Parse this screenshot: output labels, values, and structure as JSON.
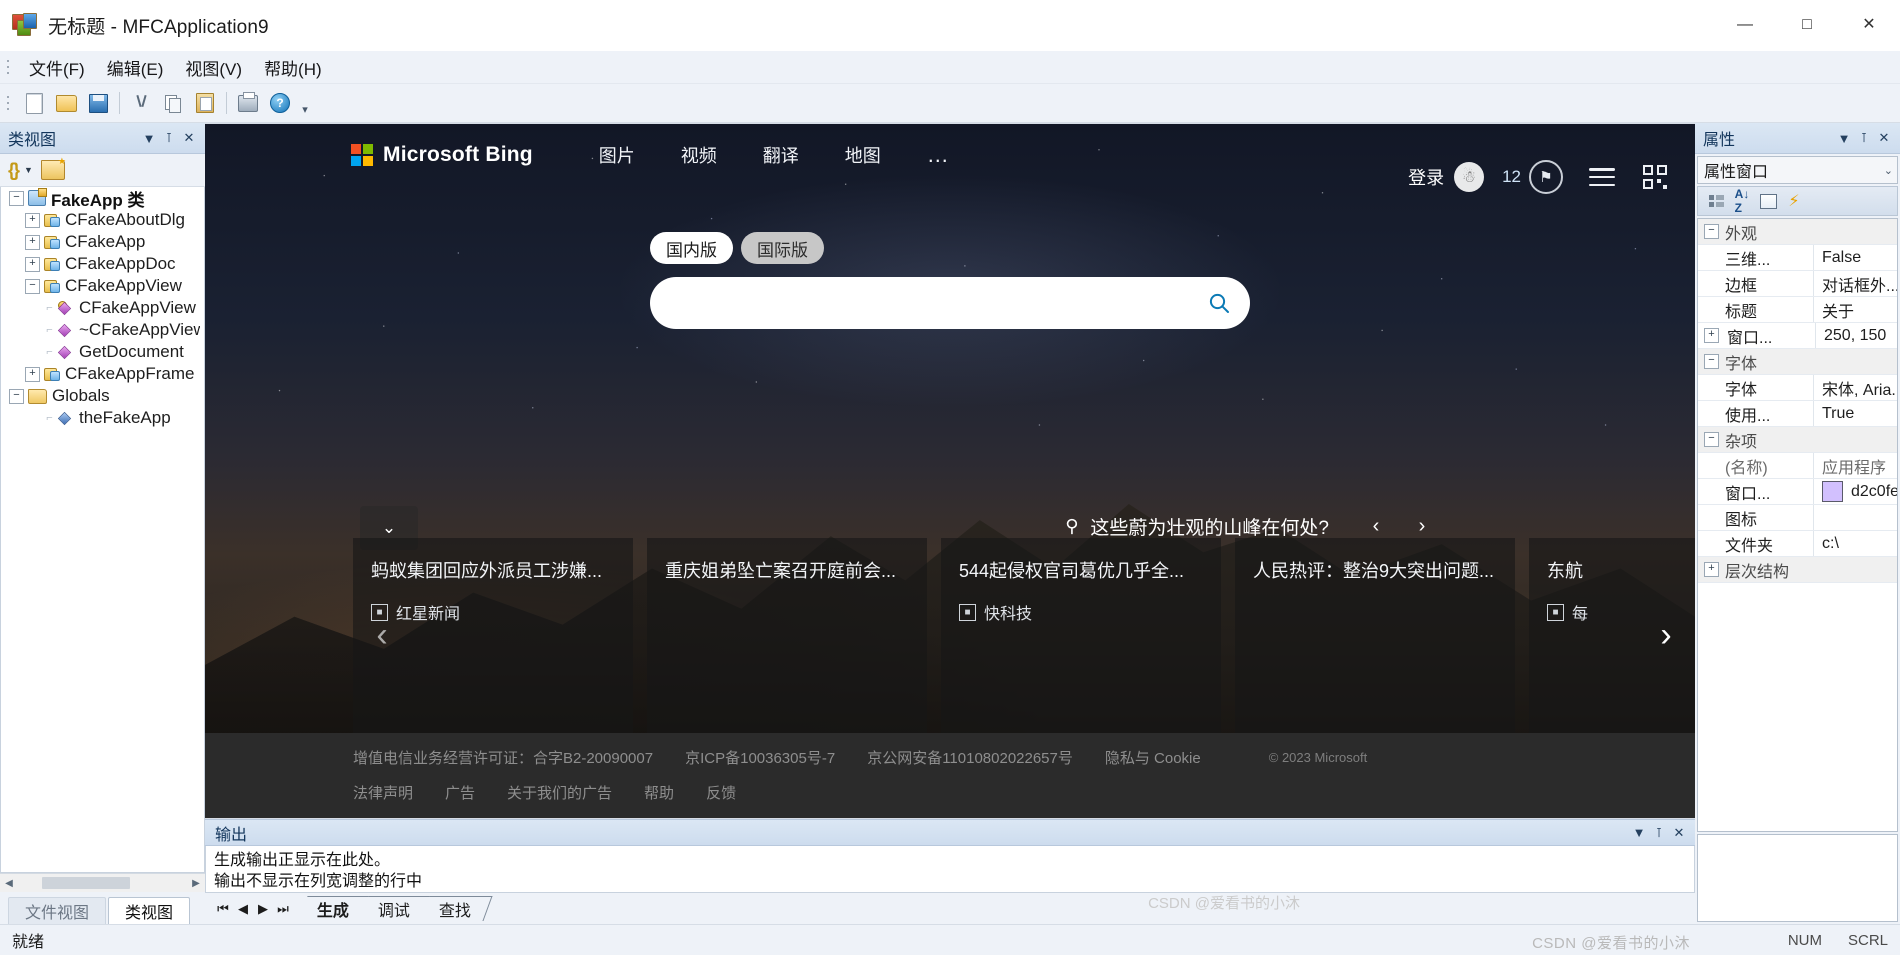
{
  "window": {
    "title": "无标题 - MFCApplication9",
    "app_icon": "mfc-app-icon",
    "minimize": "—",
    "maximize": "□",
    "close": "✕"
  },
  "menubar": {
    "items": [
      {
        "label": "文件(F)",
        "name": "menu-file"
      },
      {
        "label": "编辑(E)",
        "name": "menu-edit"
      },
      {
        "label": "视图(V)",
        "name": "menu-view"
      },
      {
        "label": "帮助(H)",
        "name": "menu-help"
      }
    ]
  },
  "toolbar": {
    "buttons": [
      "new-document-icon",
      "open-folder-icon",
      "save-icon",
      "cut-icon",
      "copy-icon",
      "paste-icon",
      "print-icon",
      "help-icon"
    ],
    "overflow": "▾"
  },
  "class_view": {
    "header_title": "类视图",
    "header_buttons": [
      "dropdown-icon",
      "pin-icon",
      "close-icon"
    ],
    "toolbar": {
      "braces": "{}",
      "caret": "▾",
      "new_folder": "new-folder-icon"
    },
    "tree": [
      {
        "indent": 0,
        "expander": "−",
        "icon": "project-icon",
        "label": "FakeApp 类",
        "bold": true
      },
      {
        "indent": 1,
        "expander": "+",
        "icon": "class-icon",
        "label": "CFakeAboutDlg"
      },
      {
        "indent": 1,
        "expander": "+",
        "icon": "class-icon",
        "label": "CFakeApp"
      },
      {
        "indent": 1,
        "expander": "+",
        "icon": "class-icon",
        "label": "CFakeAppDoc"
      },
      {
        "indent": 1,
        "expander": "−",
        "icon": "class-icon",
        "label": "CFakeAppView"
      },
      {
        "indent": 2,
        "expander": "",
        "icon": "member-key-icon",
        "label": "CFakeAppView"
      },
      {
        "indent": 2,
        "expander": "",
        "icon": "member-icon",
        "label": "~CFakeAppView"
      },
      {
        "indent": 2,
        "expander": "",
        "icon": "member-icon",
        "label": "GetDocument"
      },
      {
        "indent": 1,
        "expander": "+",
        "icon": "class-icon",
        "label": "CFakeAppFrame"
      },
      {
        "indent": 0,
        "expander": "−",
        "icon": "folder-icon",
        "label": "Globals"
      },
      {
        "indent": 1,
        "expander": "",
        "icon": "member-blue-icon",
        "label": "theFakeApp"
      }
    ],
    "tabs": [
      {
        "label": "文件视图",
        "active": false
      },
      {
        "label": "类视图",
        "active": true
      }
    ]
  },
  "bing": {
    "logo_text": "Microsoft Bing",
    "nav_links": [
      "图片",
      "视频",
      "翻译",
      "地图"
    ],
    "more_dots": "…",
    "sign_in": "登录",
    "rewards_count": "12",
    "market_tabs": [
      {
        "label": "国内版",
        "active": true
      },
      {
        "label": "国际版",
        "active": false
      }
    ],
    "search_value": "",
    "search_placeholder": "",
    "scroll_down": "⌄",
    "image_caption": "这些蔚为壮观的山峰在何处?",
    "caption_prev": "‹",
    "caption_next": "›",
    "cards_prev": "‹",
    "cards_next": "›",
    "news_cards": [
      {
        "title": "蚂蚁集团回应外派员工涉嫌...",
        "source": "红星新闻"
      },
      {
        "title": "重庆姐弟坠亡案召开庭前会...",
        "source": ""
      },
      {
        "title": "544起侵权官司葛优几乎全...",
        "source": "快科技"
      },
      {
        "title": "人民热评：整治9大突出问题...",
        "source": ""
      },
      {
        "title": "东航",
        "source": "每"
      }
    ],
    "footer_row1": [
      "增值电信业务经营许可证：合字B2-20090007",
      "京ICP备10036305号-7",
      "京公网安备11010802022657号",
      "隐私与 Cookie"
    ],
    "footer_row2": [
      "法律声明",
      "广告",
      "关于我们的广告",
      "帮助",
      "反馈"
    ],
    "copyright": "© 2023 Microsoft"
  },
  "output": {
    "header_title": "输出",
    "header_buttons": [
      "dropdown-icon",
      "pin-icon",
      "close-icon"
    ],
    "lines": [
      "生成输出正显示在此处。",
      "输出不显示在列宽调整的行中"
    ],
    "nav_arrows": [
      "⏮",
      "◀",
      "▶",
      "⏭"
    ],
    "tabs": [
      {
        "label": "生成",
        "active": true
      },
      {
        "label": "调试",
        "active": false
      },
      {
        "label": "查找",
        "active": false
      }
    ]
  },
  "properties": {
    "header_title": "属性",
    "header_buttons": [
      "dropdown-icon",
      "pin-icon",
      "close-icon"
    ],
    "combo_value": "属性窗口",
    "combo_caret": "⌄",
    "toolbar": [
      "categorized-icon",
      "alphabetical-icon",
      "properties-page-icon",
      "events-icon"
    ],
    "rows": [
      {
        "kind": "category",
        "expander": "−",
        "name": "外观",
        "value": ""
      },
      {
        "kind": "prop",
        "expander": "",
        "name": "三维...",
        "value": "False"
      },
      {
        "kind": "prop",
        "expander": "",
        "name": "边框",
        "value": "对话框外..."
      },
      {
        "kind": "prop",
        "expander": "",
        "name": "标题",
        "value": "关于"
      },
      {
        "kind": "prop",
        "expander": "+",
        "name": "窗口...",
        "value": "250, 150"
      },
      {
        "kind": "category",
        "expander": "−",
        "name": "字体",
        "value": ""
      },
      {
        "kind": "prop",
        "expander": "",
        "name": "字体",
        "value": "宋体, Aria..."
      },
      {
        "kind": "prop",
        "expander": "",
        "name": "使用...",
        "value": "True"
      },
      {
        "kind": "category",
        "expander": "−",
        "name": "杂项",
        "value": ""
      },
      {
        "kind": "prop",
        "expander": "",
        "name": "(名称)",
        "value": "应用程序",
        "dim": true
      },
      {
        "kind": "prop",
        "expander": "",
        "name": "窗口...",
        "value": "d2c0fe",
        "swatch": "#d2c0fe"
      },
      {
        "kind": "prop",
        "expander": "",
        "name": "图标",
        "value": ""
      },
      {
        "kind": "prop",
        "expander": "",
        "name": "文件夹",
        "value": "c:\\"
      },
      {
        "kind": "category",
        "expander": "+",
        "name": "层次结构",
        "value": ""
      }
    ]
  },
  "statusbar": {
    "text": "就绪",
    "indicators": [
      "NUM",
      "SCRL"
    ]
  },
  "watermarks": {
    "bottom": "CSDN @爱看书的小沐",
    "mid": "CSDN @爱看书的小沐"
  },
  "colors": {
    "accent": "#cddcee",
    "bing_dark": "#2b2b2b",
    "prop_swatch": "#d2c0fe"
  }
}
